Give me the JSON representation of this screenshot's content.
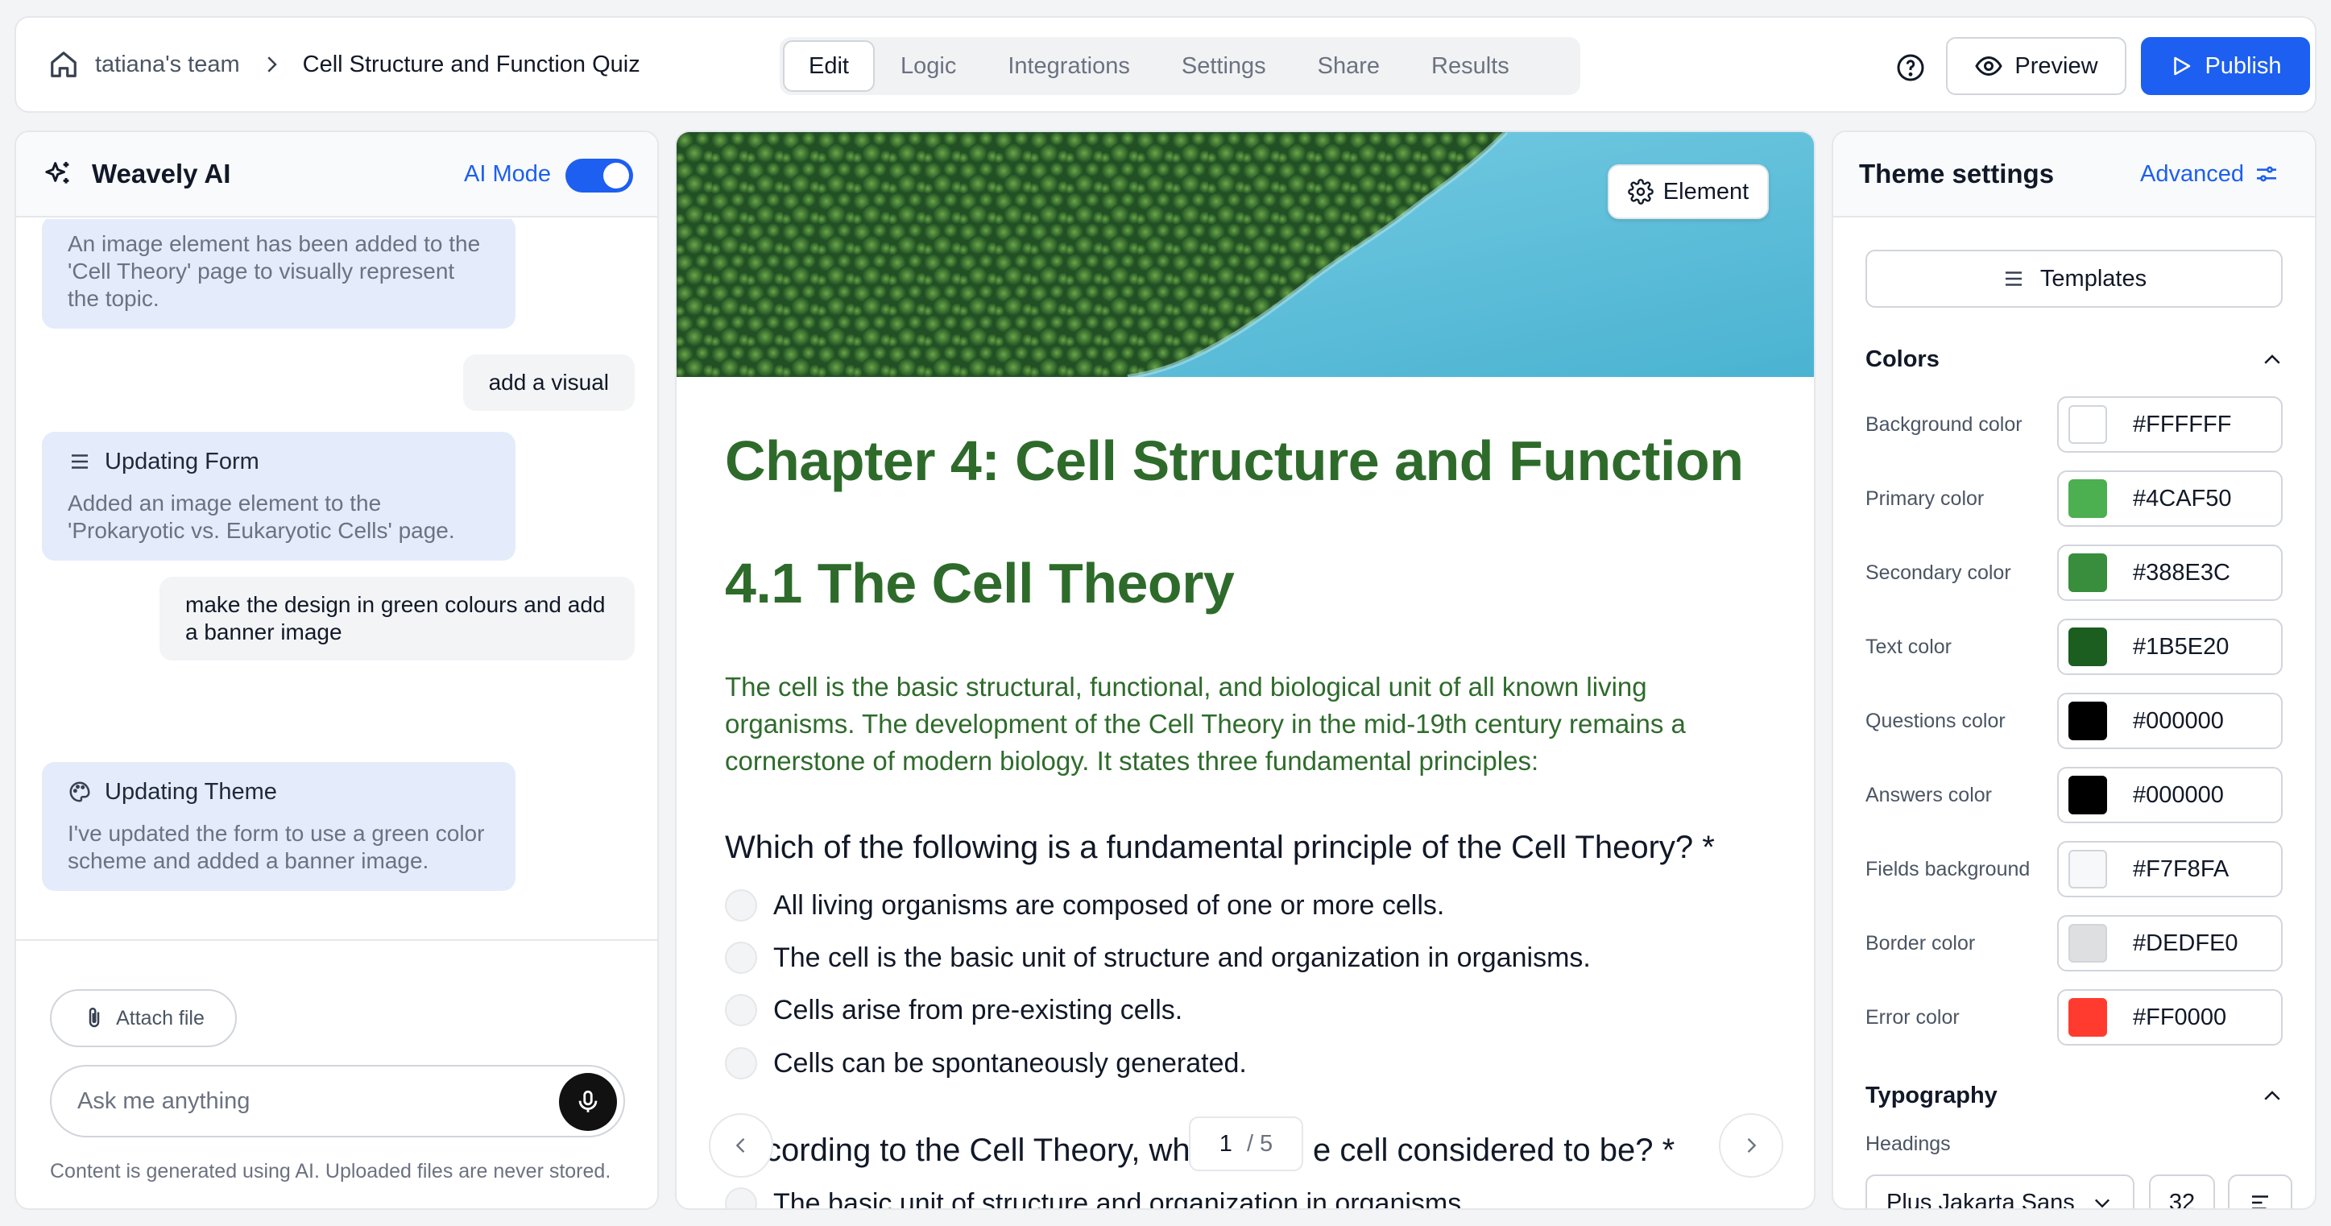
{
  "header": {
    "team": "tatiana's team",
    "title": "Cell Structure and Function Quiz",
    "tabs": [
      {
        "label": "Edit",
        "active": true
      },
      {
        "label": "Logic"
      },
      {
        "label": "Integrations"
      },
      {
        "label": "Settings"
      },
      {
        "label": "Share"
      },
      {
        "label": "Results"
      }
    ],
    "preview_label": "Preview",
    "publish_label": "Publish"
  },
  "ai_panel": {
    "name": "Weavely AI",
    "mode_label": "AI Mode",
    "mode_on": true,
    "messages": [
      {
        "role": "ai",
        "text": "An image element has been added to the 'Cell Theory' page to visually represent the topic."
      },
      {
        "role": "user",
        "text": "add a visual"
      },
      {
        "role": "ai",
        "heading": "Updating Form",
        "heading_icon": "list-icon",
        "text": "Added an image element to the 'Prokaryotic vs. Eukaryotic Cells' page."
      },
      {
        "role": "user",
        "text": "make the design in green colours and add a banner image"
      },
      {
        "role": "ai",
        "heading": "Updating Theme",
        "heading_icon": "palette-icon",
        "text": "I've updated the form to use a green color scheme and added a banner image."
      }
    ],
    "attach_label": "Attach file",
    "input_placeholder": "Ask me anything",
    "disclaimer": "Content is generated using AI. Uploaded files are never stored."
  },
  "form": {
    "element_label": "Element",
    "chapter_title": "Chapter 4: Cell Structure and Function",
    "section_title": "4.1 The Cell Theory",
    "intro": "The cell is the basic structural, functional, and biological unit of all known living organisms. The development of the Cell Theory in the mid-19th century remains a cornerstone of modern biology. It states three fundamental principles:",
    "question1": "Which of the following is a fundamental principle of the Cell Theory? *",
    "options1": [
      "All living organisms are composed of one or more cells.",
      "The cell is the basic unit of structure and organization in organisms.",
      "Cells arise from pre-existing cells.",
      "Cells can be spontaneously generated."
    ],
    "question2_left": "cording to the Cell Theory, wh",
    "question2_right": "e cell considered to be? *",
    "option2_partial": "The basic unit of structure and organization in organisms",
    "page_current": "1",
    "page_total": "/ 5"
  },
  "theme": {
    "title": "Theme settings",
    "advanced_label": "Advanced",
    "templates_label": "Templates",
    "colors_heading": "Colors",
    "colors": [
      {
        "label": "Background color",
        "hex": "#FFFFFF"
      },
      {
        "label": "Primary color",
        "hex": "#4CAF50"
      },
      {
        "label": "Secondary color",
        "hex": "#388E3C"
      },
      {
        "label": "Text color",
        "hex": "#1B5E20"
      },
      {
        "label": "Questions color",
        "hex": "#000000"
      },
      {
        "label": "Answers color",
        "hex": "#000000"
      },
      {
        "label": "Fields background",
        "hex": "#F7F8FA"
      },
      {
        "label": "Border color",
        "hex": "#DEDFE0"
      },
      {
        "label": "Error color",
        "hex": "#FF0000"
      }
    ],
    "typography_heading": "Typography",
    "headings_label": "Headings",
    "heading_font": "Plus Jakarta Sans",
    "heading_size": "32"
  }
}
